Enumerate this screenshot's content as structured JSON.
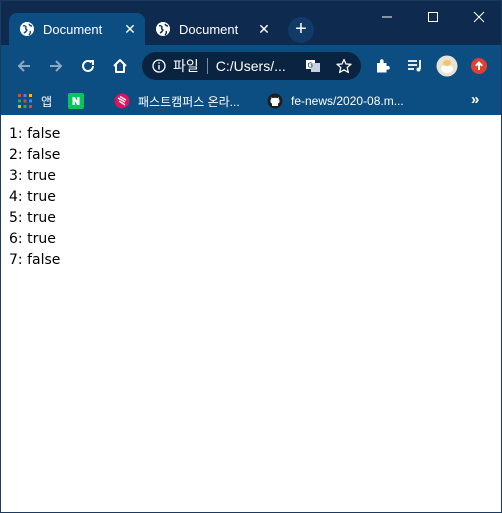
{
  "browser": {
    "tabs": [
      {
        "title": "Document",
        "active": true
      },
      {
        "title": "Document",
        "active": false
      }
    ],
    "new_tab_symbol": "+",
    "address_bar": {
      "scheme_label": "파일",
      "url": "C:/Users/..."
    },
    "bookmarks": [
      {
        "label": "앱",
        "icon": "apps-grid-icon"
      },
      {
        "label": "",
        "icon": "naver-icon"
      },
      {
        "label": "패스트캠퍼스 온라...",
        "icon": "fastcampus-icon"
      },
      {
        "label": "fe-news/2020-08.m...",
        "icon": "github-icon"
      }
    ],
    "bookmarks_overflow": "»"
  },
  "colors": {
    "titlebar": "#0e2a4e",
    "toolbar": "#0c4d82",
    "omnibox": "#0a2340",
    "page_background": "#ffffff",
    "page_text": "#000000"
  },
  "page": {
    "lines": [
      "1: false",
      "2: false",
      "3: true",
      "4: true",
      "5: true",
      "6: true",
      "7: false"
    ]
  }
}
